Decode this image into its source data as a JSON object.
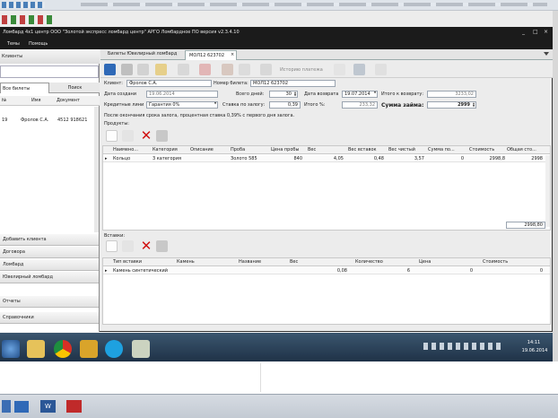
{
  "colors": {
    "titlebar": "#1b1b1b",
    "accent_blue": "#2f69b7",
    "taskbar": "#1f3247",
    "gridline": "#c9c9c9",
    "panel": "#ececec",
    "highlight": "#fbfbfb"
  },
  "top_tabs": "",
  "window": {
    "title": "Ломбард 4x1 центр  ООО \"Золотой экспресс ломбард центр\"  АРГО  Ломбардное ПО версия v2.3.4.10",
    "controls": [
      "_",
      "□",
      "×"
    ]
  },
  "menu": {
    "items": [
      "Темы",
      "Помощь"
    ]
  },
  "left_panel": {
    "header": "Клиенты",
    "tabs": [
      "Все билеты",
      "Поиск"
    ],
    "columns": [
      "№",
      "Имя",
      "Документ"
    ],
    "rows": [
      {
        "num": "19",
        "name": "Фролов С.А.",
        "doc": "4512 918621"
      }
    ],
    "nav": [
      "Добавить клиента",
      "Договора",
      "Ломбард",
      "Ювелирный ломбард",
      "Отчеты",
      "Справочники"
    ]
  },
  "doc_tabs": [
    {
      "label": "Билеты Ювелирный ломбард"
    },
    {
      "label": "МОЛ12 623702",
      "closable": true
    }
  ],
  "toolbar": {
    "print_label": "Историю платежа"
  },
  "form": {
    "client_label": "Клиент:",
    "client_value": "Фролов С.А.",
    "ticket_label": "Номер билета:",
    "ticket_value": "МОЛ12 623702",
    "date_created_label": "Дата создания:",
    "date_created_value": "19.06.2014",
    "total_days_label": "Всего дней:",
    "total_days_value": "30",
    "return_date_label": "Дата возврата:",
    "return_date_value": "19.07.2014",
    "total_return_label": "Итого к возврату:",
    "total_return_value": "3233,02",
    "credit_label": "Кредитные линии:",
    "credit_value": "Гарантия 0%",
    "rate_label": "Ставка по залогу:",
    "rate_value": "0,39",
    "total_pct_label": "Итого %:",
    "total_pct_value": "233,32",
    "loan_label": "Сумма займа:",
    "loan_value": "2999",
    "note": "После окончания срока залога, процентная ставка 0,39% с первого дня залога.",
    "products_label": "Продукты:"
  },
  "products": {
    "columns": [
      "Наимено...",
      "Категория",
      "Описание",
      "Проба",
      "Цена пробы",
      "Вес",
      "Вес вставок",
      "Вес чистый",
      "Сумма по...",
      "Стоимость",
      "Общая сто..."
    ],
    "rows": [
      {
        "name": "Кольцо",
        "category": "3 категория",
        "desc": "",
        "assay": "Золото 585",
        "assay_price": "840",
        "weight": "4,05",
        "insert_weight": "0,48",
        "net_weight": "3,57",
        "sum": "0",
        "cost": "2998,8",
        "total": "2998"
      }
    ],
    "total": "2998,80"
  },
  "inserts": {
    "label": "Вставки:",
    "columns": [
      "Тип вставки",
      "Камень",
      "Название",
      "Вес",
      "Количество",
      "Цена",
      "Стоимость"
    ],
    "rows": [
      {
        "type": "Камень синтетический",
        "stone": "",
        "name": "",
        "weight": "0,08",
        "qty": "6",
        "price": "0",
        "cost": "0"
      }
    ]
  },
  "taskbar": {
    "time": "14:11",
    "date": "19.06.2014"
  },
  "bottom_taskbar": ""
}
